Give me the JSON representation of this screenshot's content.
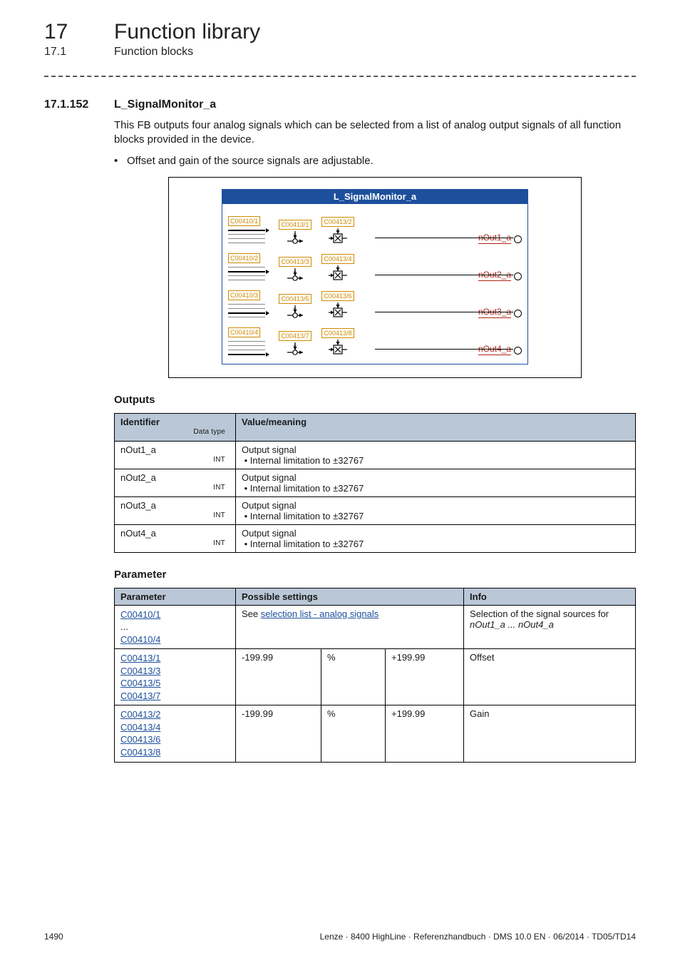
{
  "header": {
    "chapter_num": "17",
    "chapter_title": "Function library",
    "sub_num": "17.1",
    "sub_title": "Function blocks"
  },
  "section": {
    "num": "17.1.152",
    "title": "L_SignalMonitor_a",
    "intro": "This FB outputs four analog signals which can be selected from a list of analog output signals of all function blocks provided in the device.",
    "bullet": "Offset and gain of the source signals are adjustable."
  },
  "diagram": {
    "title": "L_SignalMonitor_a",
    "rows": [
      {
        "sel": "C00410/1",
        "off": "C00413/1",
        "gain": "C00413/2",
        "out": "nOut1_a"
      },
      {
        "sel": "C00410/2",
        "off": "C00413/3",
        "gain": "C00413/4",
        "out": "nOut2_a"
      },
      {
        "sel": "C00410/3",
        "off": "C00413/5",
        "gain": "C00413/6",
        "out": "nOut3_a"
      },
      {
        "sel": "C00410/4",
        "off": "C00413/7",
        "gain": "C00413/8",
        "out": "nOut4_a"
      }
    ]
  },
  "outputs": {
    "heading": "Outputs",
    "col_identifier": "Identifier",
    "col_datatype": "Data type",
    "col_value": "Value/meaning",
    "rows": [
      {
        "name": "nOut1_a",
        "type": "INT",
        "v1": "Output signal",
        "v2": "• Internal limitation to ±32767"
      },
      {
        "name": "nOut2_a",
        "type": "INT",
        "v1": "Output signal",
        "v2": "• Internal limitation to ±32767"
      },
      {
        "name": "nOut3_a",
        "type": "INT",
        "v1": "Output signal",
        "v2": "• Internal limitation to ±32767"
      },
      {
        "name": "nOut4_a",
        "type": "INT",
        "v1": "Output signal",
        "v2": "• Internal limitation to ±32767"
      }
    ]
  },
  "params": {
    "heading": "Parameter",
    "col_param": "Parameter",
    "col_settings": "Possible settings",
    "col_info": "Info",
    "row1": {
      "p_top": "C00410/1",
      "p_mid": "...",
      "p_bot": "C00410/4",
      "see_prefix": "See ",
      "see_link": "selection list - analog signals",
      "info_l1": "Selection of the signal sources for",
      "info_l2": "nOut1_a ... nOut4_a"
    },
    "row2": {
      "codes": [
        "C00413/1",
        "C00413/3",
        "C00413/5",
        "C00413/7"
      ],
      "min": "-199.99",
      "unit": "%",
      "max": "+199.99",
      "info": "Offset"
    },
    "row3": {
      "codes": [
        "C00413/2",
        "C00413/4",
        "C00413/6",
        "C00413/8"
      ],
      "min": "-199.99",
      "unit": "%",
      "max": "+199.99",
      "info": "Gain"
    }
  },
  "footer": {
    "page": "1490",
    "right": "Lenze · 8400 HighLine · Referenzhandbuch · DMS 10.0 EN · 06/2014 · TD05/TD14"
  }
}
